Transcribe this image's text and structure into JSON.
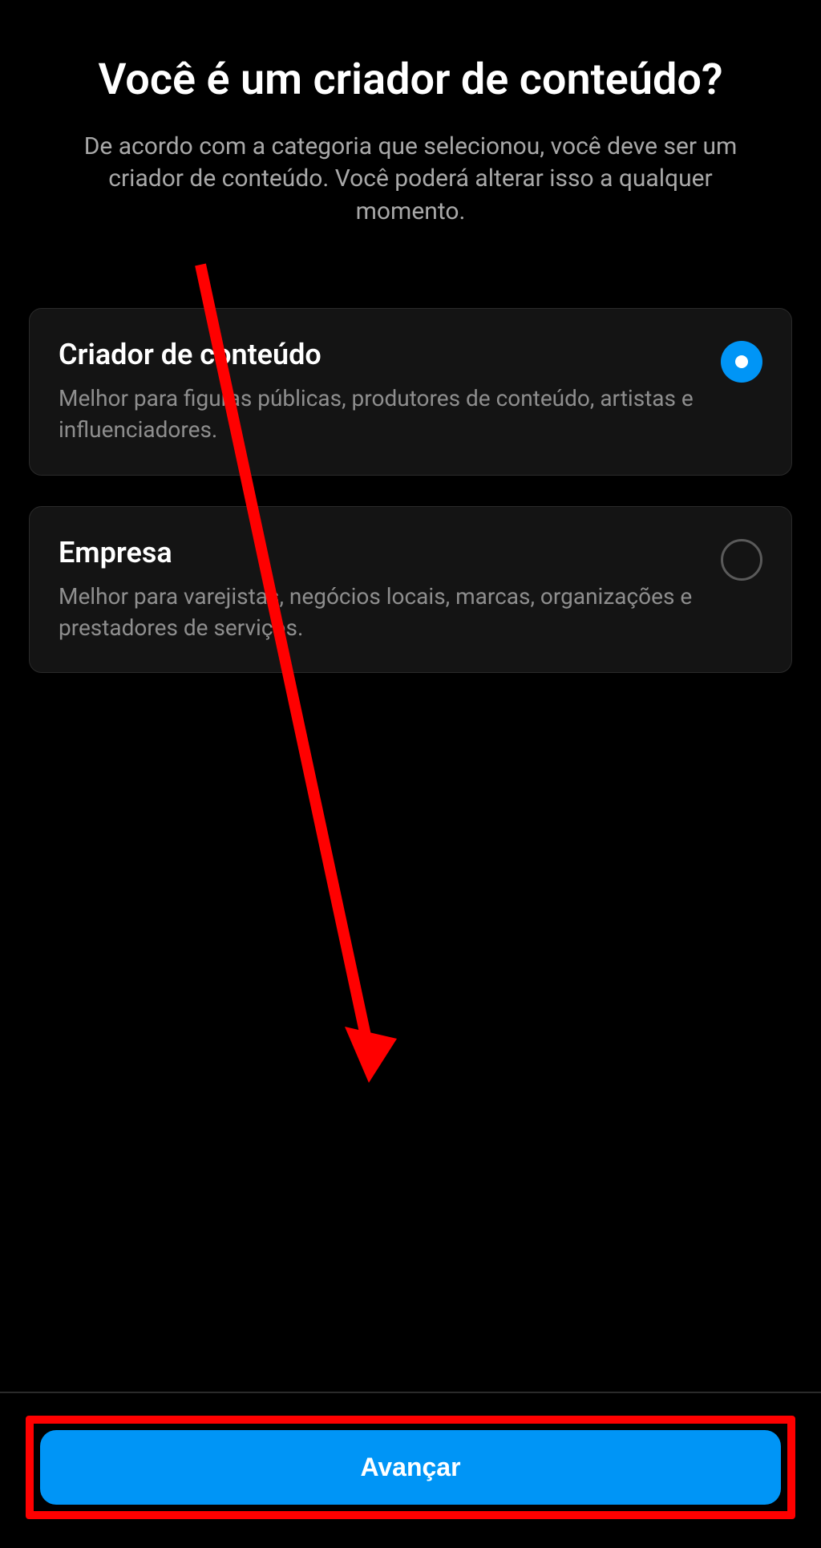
{
  "header": {
    "title": "Você é um criador de conteúdo?",
    "subtitle": "De acordo com a categoria que selecionou, você deve ser um criador de conteúdo. Você poderá alterar isso a qualquer momento."
  },
  "options": [
    {
      "title": "Criador de conteúdo",
      "description": "Melhor para figuras públicas, produtores de conteúdo, artistas e influenciadores.",
      "selected": true
    },
    {
      "title": "Empresa",
      "description": "Melhor para varejistas, negócios locais, marcas, organizações e prestadores de serviços.",
      "selected": false
    }
  ],
  "footer": {
    "primary_button_label": "Avançar"
  },
  "colors": {
    "accent": "#0095f6",
    "annotation": "#ff0000"
  }
}
